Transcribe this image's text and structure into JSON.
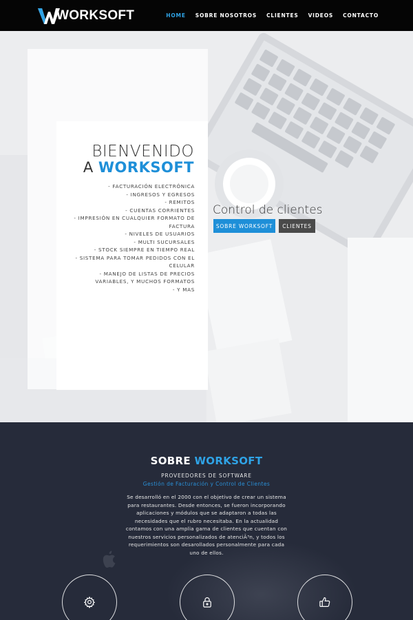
{
  "nav": {
    "logo_text": "WORKSOFT",
    "items": [
      {
        "label": "HOME",
        "active": true
      },
      {
        "label": "SOBRE NOSOTROS",
        "active": false
      },
      {
        "label": "CLIENTES",
        "active": false
      },
      {
        "label": "VIDEOS",
        "active": false
      },
      {
        "label": "CONTACTO",
        "active": false
      }
    ],
    "active_color": "#2fa3e6"
  },
  "hero": {
    "title_line1": "BIENVENIDO",
    "title_line2_prefix": "A",
    "title_line2_accent": "WORKSOFT",
    "features": [
      "- FACTURACIÓN ELECTRÓNICA",
      "- INGRESOS Y EGRESOS",
      "- REMITOS",
      "- CUENTAS CORRIENTES",
      "- IMPRESIÓN EN CUALQUIER FORMATO DE FACTURA",
      "- NIVELES DE USUARIOS",
      "- MULTI SUCURSALES",
      "- STOCK SIEMPRE EN TIEMPO REAL",
      "- SISTEMA PARA TOMAR PEDIDOS CON EL CELULAR",
      "- MANEJO DE LISTAS DE PRECIOS VARIABLES, Y MUCHOS FORMATOS",
      "- Y MAS"
    ],
    "subtitle": "Control de clientes",
    "btn_primary": "SOBRE WORKSOFT",
    "btn_secondary": "CLIENTES",
    "accent_color": "#1e8fd8"
  },
  "about": {
    "title_prefix": "SOBRE",
    "title_accent": "WORKSOFT",
    "subtitle": "PROVEEDORES DE SOFTWARE",
    "subtitle2": "Gestión de Facturación y Control de Clientes",
    "body": "Se desarrolló en el 2000 con el objetivo de crear un sistema para restaurantes. Desde entonces, se fueron incorporando aplicaciones y módulos que se adaptaron a todas las necesidades que el rubro necesitaba. En la actualidad contamos con una amplia gama de clientes que cuentan con nuestros servicios personalizados de atenciÃ³n, y todos los requerimientos son desarollados personalmente para cada uno de ellos.",
    "icons": [
      "gear-icon",
      "lock-icon",
      "thumbs-up-icon"
    ],
    "bg_color": "#262b3a"
  }
}
